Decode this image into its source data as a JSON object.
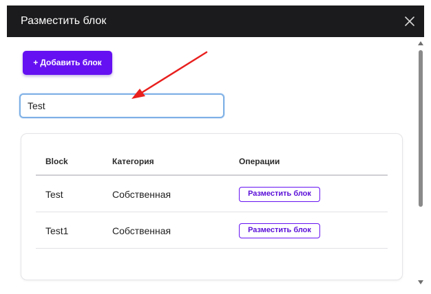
{
  "dialog": {
    "title": "Разместить блок",
    "close_icon": "close-icon"
  },
  "toolbar": {
    "add_plus": "+",
    "add_label": "Добавить блок"
  },
  "search": {
    "value": "Test",
    "placeholder": ""
  },
  "table": {
    "headers": [
      "Block",
      "Категория",
      "Операции"
    ],
    "rows": [
      {
        "block": "Test",
        "category": "Собственная",
        "action": "Разместить блок"
      },
      {
        "block": "Test1",
        "category": "Собственная",
        "action": "Разместить блок"
      }
    ]
  },
  "colors": {
    "accent": "#6510f2",
    "titlebar": "#1b1b1d",
    "annotation_arrow": "#e8201e",
    "search_focus": "#7eb0e6"
  },
  "annotation": {
    "icon": "red-arrow-icon"
  }
}
